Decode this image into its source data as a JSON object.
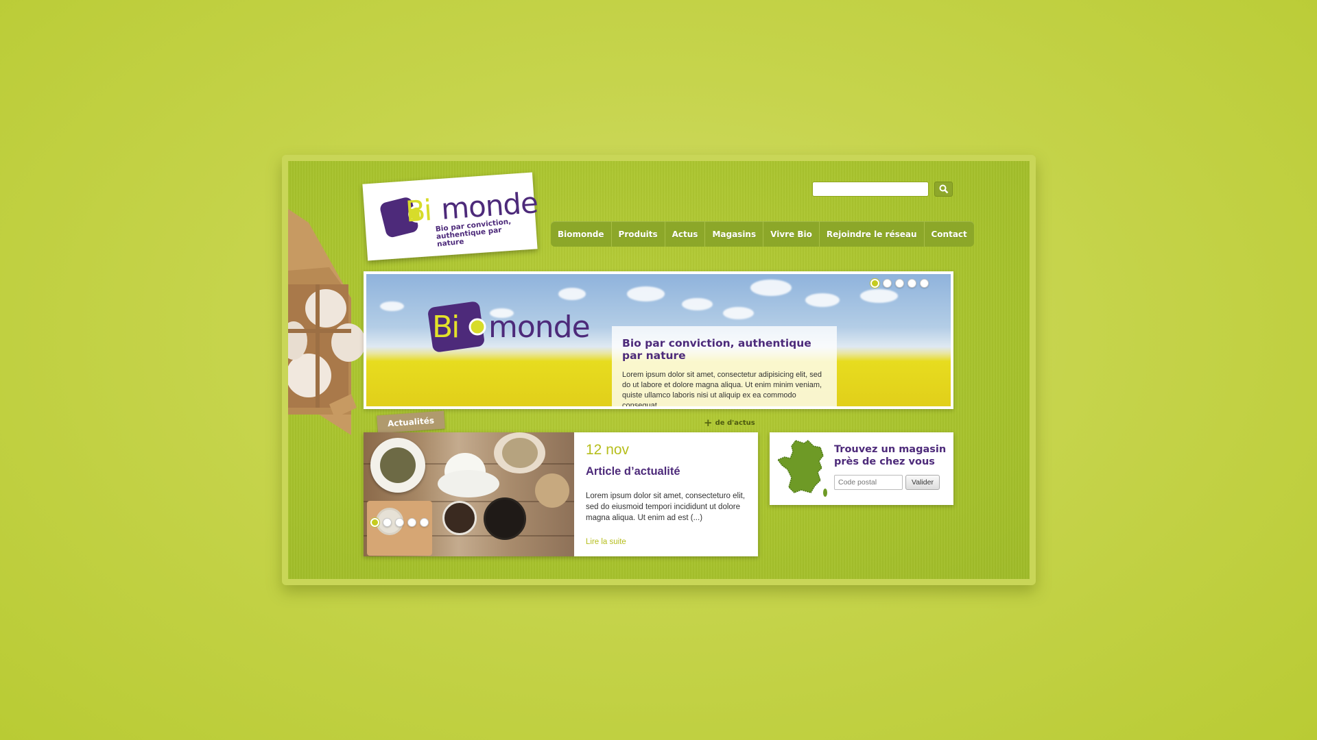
{
  "search": {
    "placeholder": ""
  },
  "logo": {
    "bio": "Bi",
    "monde": "monde",
    "tagline_line1": "Bio par conviction,",
    "tagline_line2": "authentique par nature"
  },
  "nav": {
    "items": [
      {
        "label": "Biomonde"
      },
      {
        "label": "Produits"
      },
      {
        "label": "Actus"
      },
      {
        "label": "Magasins"
      },
      {
        "label": "Vivre Bio"
      },
      {
        "label": "Rejoindre le réseau"
      },
      {
        "label": "Contact"
      }
    ]
  },
  "hero": {
    "logo_bio": "Bi",
    "logo_monde": "monde",
    "title": "Bio par conviction, authentique par nature",
    "text": "Lorem ipsum dolor sit amet, consectetur adipisicing elit, sed do ut labore et dolore magna aliqua. Ut enim minim veniam, quiste ullamco laboris nisi ut aliquip ex ea commodo consequat.",
    "slides": 5,
    "active_slide": 1
  },
  "news": {
    "tab_label": "Actualités",
    "more_label": "de d'actus",
    "date": "12 nov",
    "title": "Article d’actualité",
    "text": "Lorem ipsum dolor sit amet, consecteturo elit, sed do eiusmoid tempori incididunt ut dolore magna aliqua. Ut enim ad est (...)",
    "read_more": "Lire la suite",
    "slides": 5,
    "active_slide": 1
  },
  "store_finder": {
    "title": "Trouvez un magasin près de chez vous",
    "postal_placeholder": "Code postal",
    "button_label": "Valider"
  },
  "colors": {
    "brand_purple": "#4d2a7a",
    "brand_lime": "#c5cc1f",
    "nav_green": "#8ca729",
    "background": "#c6d44c"
  }
}
